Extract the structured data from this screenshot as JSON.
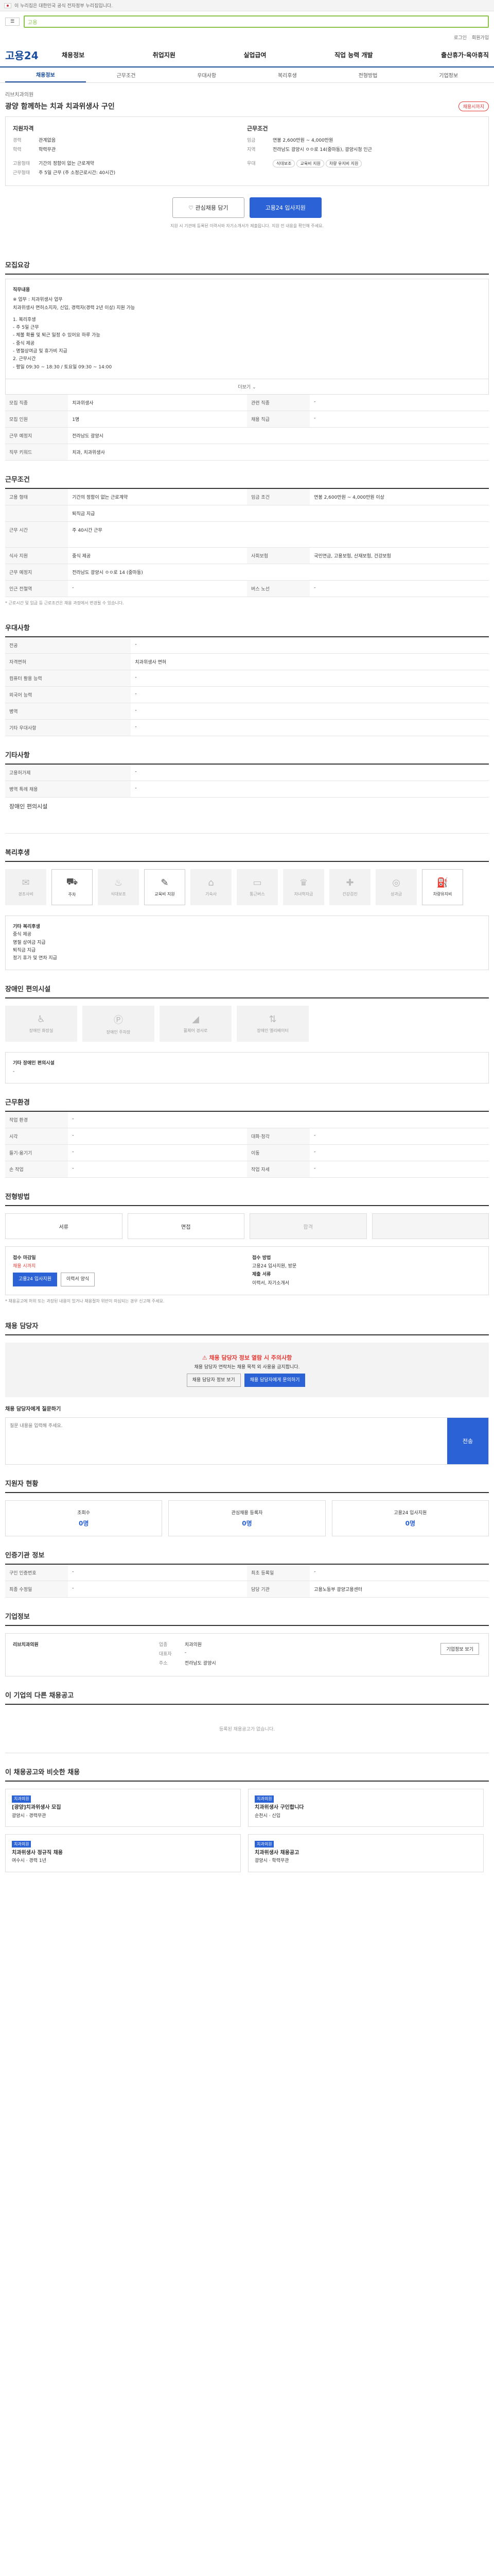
{
  "gov_banner": "이 누리집은 대한민국 공식 전자정부 누리집입니다.",
  "top": {
    "search_mark": "고용",
    "util": [
      "로그인",
      "회원가입"
    ]
  },
  "logo": "고용24",
  "gnb": [
    "채용정보",
    "취업지원",
    "실업급여",
    "직업 능력 개발",
    "출산휴가·육아휴직"
  ],
  "tabs": [
    "채용정보",
    "근무조건",
    "우대사항",
    "복리후생",
    "전형방법",
    "기업정보"
  ],
  "hero": {
    "company": "리브치과의원",
    "title": "광양 함께하는 치과 치과위생사 구인",
    "badge": "채용시까지"
  },
  "summary": {
    "h_left": "지원자격",
    "h_right": "근무조건",
    "left": [
      [
        "경력",
        "관계없음"
      ],
      [
        "학력",
        "학력무관"
      ],
      [
        "",
        ""
      ],
      [
        "고용형태",
        "기간의 정함이 없는 근로계약"
      ],
      [
        "근무형태",
        "주 5일 근무 (주 소정근로시간: 40시간)"
      ]
    ],
    "right": [
      [
        "임금",
        "연봉 2,600만원 ~ 4,000만원"
      ],
      [
        "지역",
        "전라남도 광양시 ㅇㅇ로 14(중마동), 광양시청 인근"
      ],
      [
        "",
        ""
      ],
      [
        "우대",
        "자격증 의료계 지원 경력"
      ]
    ],
    "chips": [
      "식대보조",
      "교육비 지원",
      "차량 유지비 지원"
    ]
  },
  "buttons": {
    "scrap": "관심채용 담기",
    "apply": "고용24 입사지원"
  },
  "note": "지원 시 기관에 등록된 이력서와 자기소개서가 제출됩니다. 지원 전 내용을 확인해 주세요.",
  "job": {
    "h": "모집요강",
    "desc_title": "직무내용",
    "desc": [
      "※ 업무 : 치과위생사 업무",
      "치과위생사 면허소지자, 신입, 경력자(경력 2년 이상) 지원 가능",
      "",
      "1. 복리후생",
      "- 주 5일 근무",
      "- 체불 확률 및 퇴근 일정 수 있어요 하루 가능",
      "- 중식 제공",
      "- 명절상여금 및 휴가비 지급",
      "2. 근무시간",
      "- 평일 09:30 ~ 18:30 / 토요일 09:30 ~ 14:00"
    ],
    "more": "더보기",
    "rows": [
      [
        "모집 직종",
        "치과위생사",
        "관련 직종",
        "-"
      ],
      [
        "모집 인원",
        "1명",
        "채용 직급",
        "-"
      ],
      [
        "근무 예정지",
        "전라남도 광양시",
        "",
        ""
      ],
      [
        "직무 키워드",
        "치과, 치과위생사",
        "",
        ""
      ]
    ]
  },
  "cond": {
    "h": "근무조건",
    "rows": [
      [
        "고용 형태",
        "기간의 정함이 없는 근로계약",
        "임금 조건",
        "연봉 2,600만원 ~ 4,000만원 이상"
      ],
      [
        "",
        "퇴직금 지급",
        "",
        ""
      ],
      [
        "근무 시간",
        "주 40시간 근무",
        "",
        ""
      ],
      [
        "식사 지원",
        "중식 제공",
        "사회보험",
        "국민연금, 고용보험, 산재보험, 건강보험"
      ],
      [
        "근무 예정지",
        "전라남도 광양시 ㅇㅇ로 14 (중마동)",
        "",
        ""
      ],
      [
        "인근 전철역",
        "-",
        "버스 노선",
        "-"
      ]
    ],
    "fine": "* 근로시간 및 임금 등 근로조건은 채용 과정에서 변경될 수 있습니다."
  },
  "pref": {
    "h": "우대사항",
    "rows": [
      [
        "전공",
        "-"
      ],
      [
        "자격면허",
        "치과위생사 면허"
      ],
      [
        "컴퓨터 활용 능력",
        "-"
      ],
      [
        "외국어 능력",
        "-"
      ],
      [
        "병역",
        "-"
      ],
      [
        "기타 우대사항",
        "-"
      ]
    ]
  },
  "etc": {
    "h": "기타사항",
    "rows": [
      [
        "고용허가제",
        "-"
      ],
      [
        "병역 특례 채용",
        "-"
      ]
    ],
    "sub": "장애인 편의시설"
  },
  "welfare": {
    "h": "복리후생",
    "items": [
      "경조사비",
      "주차",
      "식대보조",
      "교육비 지원",
      "기숙사",
      "통근버스",
      "자녀학자금",
      "건강검진",
      "성과급",
      "차량유지비"
    ],
    "text_title": "기타 복리후생",
    "text": [
      "중식 제공",
      "명절 상여금 지급",
      "퇴직금 지급",
      "정기 휴가 및 연차 지급"
    ]
  },
  "disab": {
    "h": "장애인 편의시설",
    "items": [
      "장애인 화장실",
      "장애인 주차장",
      "휠체어 경사로",
      "장애인 엘리베이터"
    ],
    "text_title": "기타 장애인 편의시설",
    "text": "-"
  },
  "work": {
    "h": "근무환경",
    "rows": [
      [
        "작업 환경",
        "-",
        "",
        ""
      ],
      [
        "시각",
        "-",
        "대화·청각",
        "-"
      ],
      [
        "들기·옮기기",
        "-",
        "이동",
        "-"
      ],
      [
        "손 작업",
        "-",
        "작업 자세",
        "-"
      ]
    ]
  },
  "proc": {
    "h": "전형방법",
    "steps": [
      "서류",
      "면접",
      "합격",
      ""
    ],
    "l_h": "접수 마감일",
    "l_date": "채용 시까지",
    "r_h": "접수 방법",
    "r_text": "고용24 입사지원, 방문",
    "doc_h": "제출 서류",
    "doc_text": "이력서, 자기소개서",
    "btn1": "고용24 입사지원",
    "btn2": "이력서 양식",
    "warn": "* 채용공고에 허위 또는 과장된 내용이 있거나 채용절차 위반이 의심되는 경우 신고해 주세요."
  },
  "qa": {
    "h": "채용 담당자",
    "alert_t": "채용 담당자 정보 열람 시 주의사항",
    "alert": "채용 담당자 연락처는 채용 목적 외 사용을 금지합니다.",
    "btn1": "채용 담당자 정보 보기",
    "btn2": "채용 담당자에게 문의하기",
    "input_h": "채용 담당자에게 질문하기",
    "placeholder": "질문 내용을 입력해 주세요.",
    "go": "전송"
  },
  "status": {
    "h": "지원자 현황",
    "items": [
      [
        "조회수",
        "0명"
      ],
      [
        "관심채용 등록자",
        "0명"
      ],
      [
        "고용24 입사지원",
        "0명"
      ]
    ]
  },
  "info": {
    "h": "인증기관 정보",
    "rows": [
      [
        "구인 인증번호",
        "-",
        "최초 등록일",
        "-"
      ],
      [
        "최종 수정일",
        "-",
        "담당 기관",
        "고용노동부 광양고용센터"
      ]
    ]
  },
  "corp": {
    "h": "기업정보",
    "name": "리브치과의원",
    "rows": [
      [
        "업종",
        "치과의원"
      ],
      [
        "대표자",
        "-"
      ],
      [
        "주소",
        "전라남도 광양시"
      ]
    ],
    "btn": "기업정보 보기"
  },
  "other": {
    "h": "이 기업의 다른 채용공고",
    "empty": "등록된 채용공고가 없습니다."
  },
  "recom": {
    "h": "이 채용공고와 비슷한 채용",
    "cards": [
      [
        "치과의원",
        "[광양]치과위생사 모집",
        "광양시 · 경력무관"
      ],
      [
        "치과의원",
        "치과위생사 구인합니다",
        "순천시 · 신입"
      ],
      [
        "치과의원",
        "치과위생사 정규직 채용",
        "여수시 · 경력 1년"
      ],
      [
        "치과의원",
        "치과위생사 채용공고",
        "광양시 · 학력무관"
      ]
    ]
  }
}
